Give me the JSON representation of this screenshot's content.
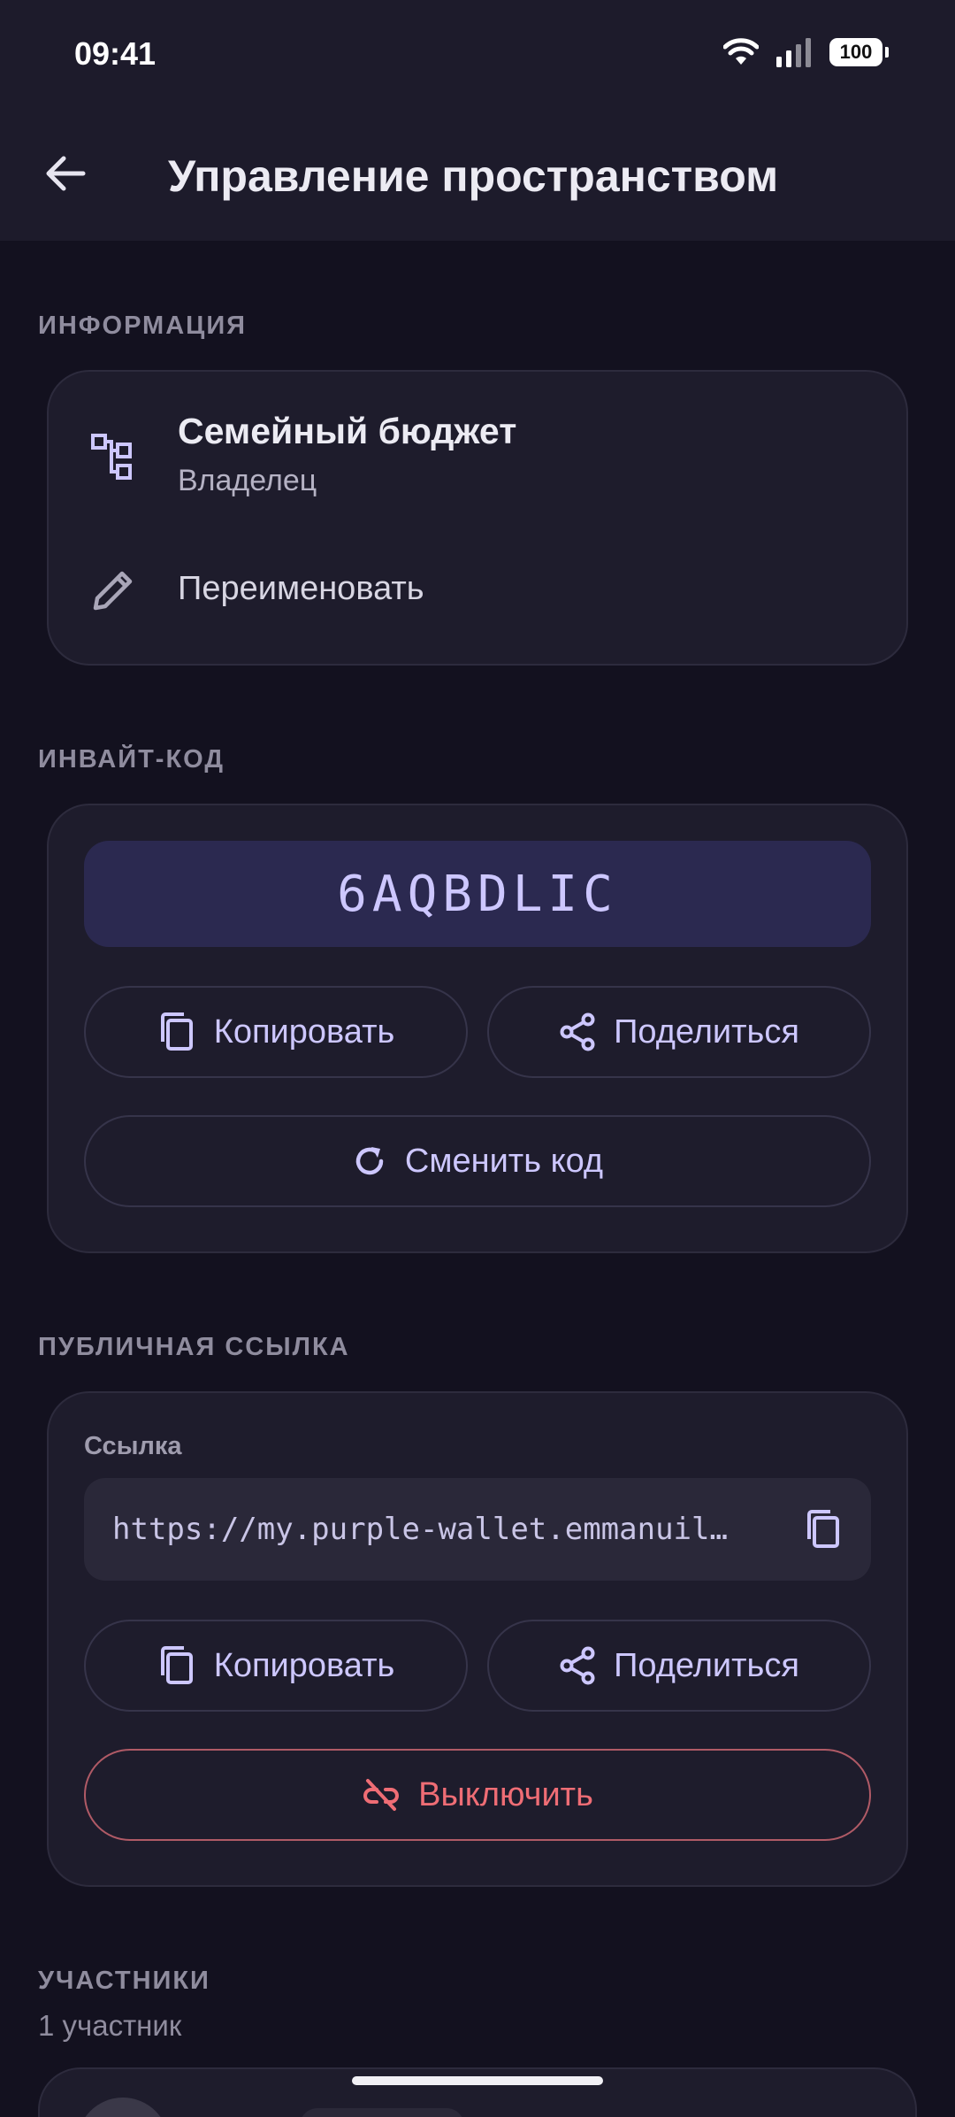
{
  "status_bar": {
    "time": "09:41",
    "battery": "100"
  },
  "app_bar": {
    "title": "Управление пространством",
    "back_icon": "arrow-left-icon"
  },
  "sections": {
    "info": {
      "label": "ИНФОРМАЦИЯ",
      "space_name": "Семейный бюджет",
      "role": "Владелец",
      "rename_label": "Переименовать"
    },
    "invite": {
      "label": "ИНВАЙТ-КОД",
      "code": "6AQBDLIC",
      "copy_label": "Копировать",
      "share_label": "Поделиться",
      "regenerate_label": "Сменить код"
    },
    "public_link": {
      "label": "ПУБЛИЧНАЯ ССЫЛКА",
      "field_label": "Ссылка",
      "url": "https://my.purple-wallet.emmanuil…",
      "copy_label": "Копировать",
      "share_label": "Поделиться",
      "disable_label": "Выключить"
    },
    "members": {
      "label": "УЧАСТНИКИ",
      "count_text": "1 участник"
    }
  },
  "colors": {
    "background": "#13111f",
    "surface": "#1e1c2c",
    "accent": "#cdc7ff",
    "danger": "#ef6d75"
  }
}
